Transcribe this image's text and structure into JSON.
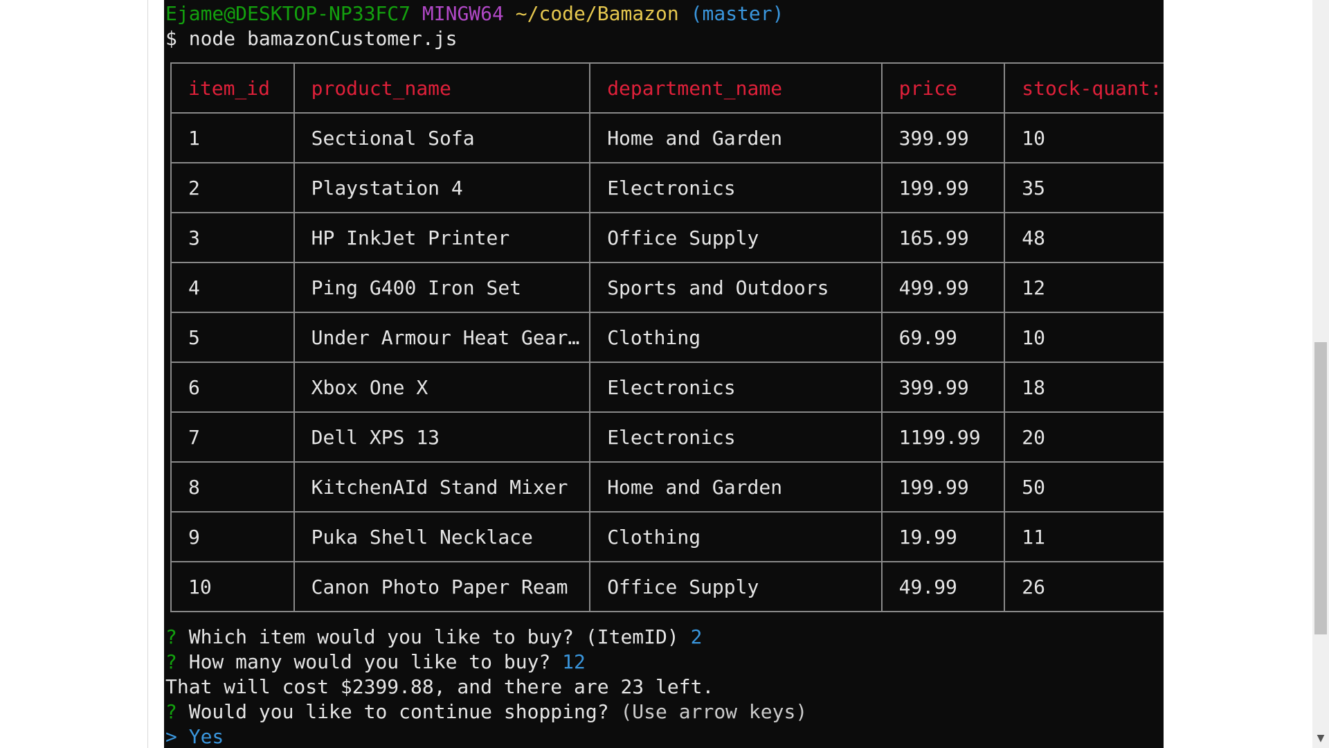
{
  "prompt": {
    "user_host": "Ejame@DESKTOP-NP33FC7",
    "shell": "MINGW64",
    "path": "~/code/Bamazon",
    "branch": "(master)"
  },
  "command": {
    "symbol": "$",
    "text": "node bamazonCustomer.js"
  },
  "table": {
    "headers": [
      "item_id",
      "product_name",
      "department_name",
      "price",
      "stock-quant:"
    ],
    "rows": [
      [
        "1",
        "Sectional Sofa",
        "Home and Garden",
        "399.99",
        "10"
      ],
      [
        "2",
        "Playstation 4",
        "Electronics",
        "199.99",
        "35"
      ],
      [
        "3",
        "HP InkJet Printer",
        "Office Supply",
        "165.99",
        "48"
      ],
      [
        "4",
        "Ping G400 Iron Set",
        "Sports and Outdoors",
        "499.99",
        "12"
      ],
      [
        "5",
        "Under Armour Heat Gear…",
        "Clothing",
        "69.99",
        "10"
      ],
      [
        "6",
        "Xbox One X",
        "Electronics",
        "399.99",
        "18"
      ],
      [
        "7",
        "Dell XPS 13",
        "Electronics",
        "1199.99",
        "20"
      ],
      [
        "8",
        "KitchenAId Stand Mixer",
        "Home and Garden",
        "199.99",
        "50"
      ],
      [
        "9",
        "Puka Shell Necklace",
        "Clothing",
        "19.99",
        "11"
      ],
      [
        "10",
        "Canon Photo Paper Ream",
        "Office Supply",
        "49.99",
        "26"
      ]
    ]
  },
  "dialog": {
    "q1_mark": "?",
    "q1_text": "Which item would you like to buy? (ItemID)",
    "q1_answer": "2",
    "q2_mark": "?",
    "q2_text": "How many would you like to buy?",
    "q2_answer": "12",
    "result": "That will cost $2399.88, and there are 23 left.",
    "q3_mark": "?",
    "q3_text": "Would you like to continue shopping?",
    "q3_hint": "(Use arrow keys)",
    "selection_marker": ">",
    "selection": "Yes"
  },
  "colors": {
    "terminal_bg": "#0c0c0c",
    "header_red": "#e0203a",
    "prompt_green": "#13a10e",
    "prompt_magenta": "#b148c6",
    "prompt_yellow": "#e6c84f",
    "answer_cyan": "#3a96dd"
  }
}
